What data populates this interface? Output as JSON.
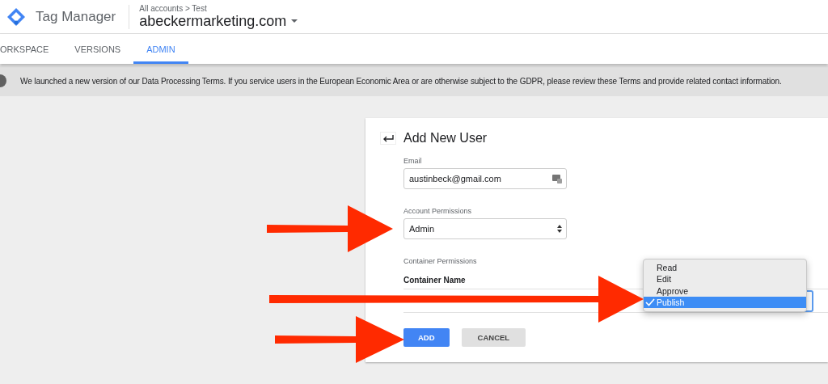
{
  "app": {
    "name": "Tag Manager",
    "breadcrumb": "All accounts > Test",
    "container": "abeckermarketing.com"
  },
  "tabs": [
    {
      "label": "ORKSPACE",
      "selected": false
    },
    {
      "label": "VERSIONS",
      "selected": false
    },
    {
      "label": "ADMIN",
      "selected": true
    }
  ],
  "banner": {
    "text": "We launched a new version of our Data Processing Terms. If you service users in the European Economic Area or are otherwise subject to the GDPR, please review these Terms and provide related contact information."
  },
  "dialog": {
    "title": "Add New User",
    "email": {
      "label": "Email",
      "value": "austinbeck@gmail.com"
    },
    "account_permissions": {
      "label": "Account Permissions",
      "value": "Admin"
    },
    "container_permissions": {
      "label": "Container Permissions",
      "column": "Container Name",
      "options": [
        {
          "label": "Read",
          "selected": false
        },
        {
          "label": "Edit",
          "selected": false
        },
        {
          "label": "Approve",
          "selected": false
        },
        {
          "label": "Publish",
          "selected": true
        }
      ]
    },
    "buttons": [
      {
        "label": "ADD",
        "kind": "primary"
      },
      {
        "label": "CANCEL",
        "kind": "secondary"
      }
    ]
  }
}
